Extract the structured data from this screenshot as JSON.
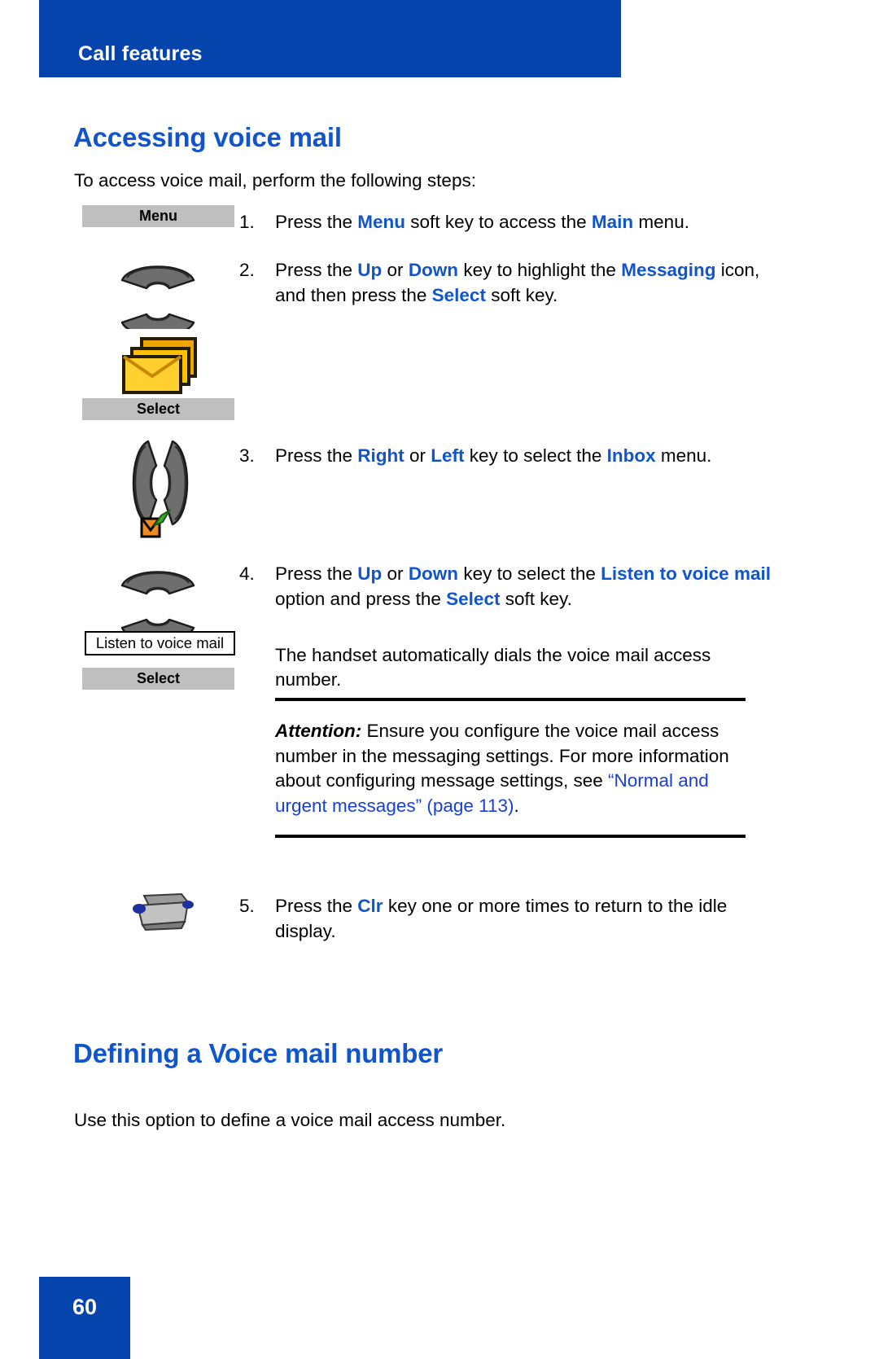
{
  "header": {
    "title": "Call features"
  },
  "sections": [
    {
      "heading": "Accessing voice mail",
      "intro": "To access voice mail, perform the following steps:"
    },
    {
      "heading": "Defining a Voice mail number",
      "intro": "Use this option to define a voice mail access number."
    }
  ],
  "steps": [
    {
      "number": "1.",
      "text_parts": [
        {
          "t": "Press the ",
          "kw": false
        },
        {
          "t": "Menu",
          "kw": true
        },
        {
          "t": " soft key to access the ",
          "kw": false
        },
        {
          "t": "Main",
          "kw": true
        },
        {
          "t": " menu.",
          "kw": false
        }
      ]
    },
    {
      "number": "2.",
      "text_parts": [
        {
          "t": "Press the ",
          "kw": false
        },
        {
          "t": "Up",
          "kw": true
        },
        {
          "t": " or ",
          "kw": false
        },
        {
          "t": "Down",
          "kw": true
        },
        {
          "t": " key to highlight the ",
          "kw": false
        },
        {
          "t": "Messaging",
          "kw": true
        },
        {
          "t": " icon, and then press the ",
          "kw": false
        },
        {
          "t": "Select",
          "kw": true
        },
        {
          "t": " soft key.",
          "kw": false
        }
      ]
    },
    {
      "number": "3.",
      "text_parts": [
        {
          "t": "Press the ",
          "kw": false
        },
        {
          "t": "Right",
          "kw": true
        },
        {
          "t": " or ",
          "kw": false
        },
        {
          "t": "Left",
          "kw": true
        },
        {
          "t": " key to select the ",
          "kw": false
        },
        {
          "t": "Inbox",
          "kw": true
        },
        {
          "t": " menu.",
          "kw": false
        }
      ]
    },
    {
      "number": "4.",
      "text_parts": [
        {
          "t": "Press the ",
          "kw": false
        },
        {
          "t": "Up",
          "kw": true
        },
        {
          "t": " or ",
          "kw": false
        },
        {
          "t": "Down",
          "kw": true
        },
        {
          "t": " key to select the ",
          "kw": false
        },
        {
          "t": "Listen to voice mail",
          "kw": true
        },
        {
          "t": " option and press the ",
          "kw": false
        },
        {
          "t": "Select",
          "kw": true
        },
        {
          "t": " soft key.",
          "kw": false
        }
      ]
    },
    {
      "number": "5.",
      "text_parts": [
        {
          "t": "Press the ",
          "kw": false
        },
        {
          "t": "Clr",
          "kw": true
        },
        {
          "t": " key one or more times to return to the idle display.",
          "kw": false
        }
      ]
    }
  ],
  "follow_text": "The handset automatically dials the voice mail access number.",
  "note": {
    "label": "Attention:",
    "text_before": " Ensure you configure the voice mail access number in the messaging settings. For more information about configuring message settings, see ",
    "xref_title": "“Normal and urgent messages”",
    "xref_page": " (page 113)",
    "text_after": "."
  },
  "softkeys": {
    "menu": "Menu",
    "select_1": "Select",
    "select_2": "Select"
  },
  "option_box": {
    "label": "Listen to voice mail"
  },
  "icons": {
    "updown_1": "up-down-navigation-key-icon",
    "updown_2": "up-down-navigation-key-icon",
    "leftright": "left-right-navigation-key-icon",
    "messaging": "messaging-envelope-icon",
    "inbox": "inbox-icon",
    "clr": "clr-key-icon"
  },
  "page": {
    "number": "60"
  },
  "colors": {
    "brand_blue": "#0544ac",
    "heading_blue": "#1155cc",
    "keyword_blue": "#1155cc",
    "xref_blue": "#1a3fd4",
    "softkey_gray": "#bfbfbf"
  }
}
